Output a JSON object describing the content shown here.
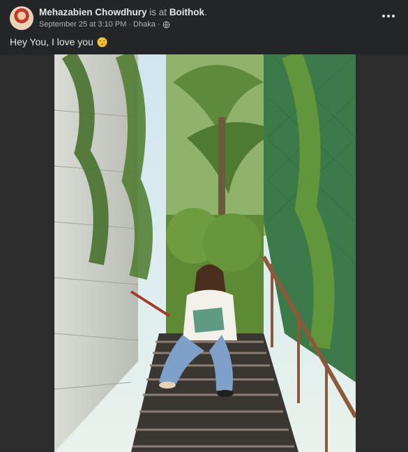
{
  "post": {
    "author_name": "Mehazabien Chowdhury",
    "is_at_text": "is at",
    "place_name": "Boithok",
    "place_suffix": ".",
    "date": "September 25 at 3:10 PM",
    "separator": "·",
    "location": "Dhaka",
    "separator2": "·",
    "privacy_icon": "globe-icon",
    "more_icon": "more-horizontal-icon",
    "caption_text": "Hey You, I love you",
    "caption_emoji": "kissing-face-emoji",
    "photo_alt": "Woman sitting on an outdoor staircase surrounded by green plants"
  },
  "colors": {
    "background": "#242526",
    "primary_text": "#e4e6eb",
    "secondary_text": "#b0b3b8",
    "media_letterbox": "#2d2d2d"
  }
}
